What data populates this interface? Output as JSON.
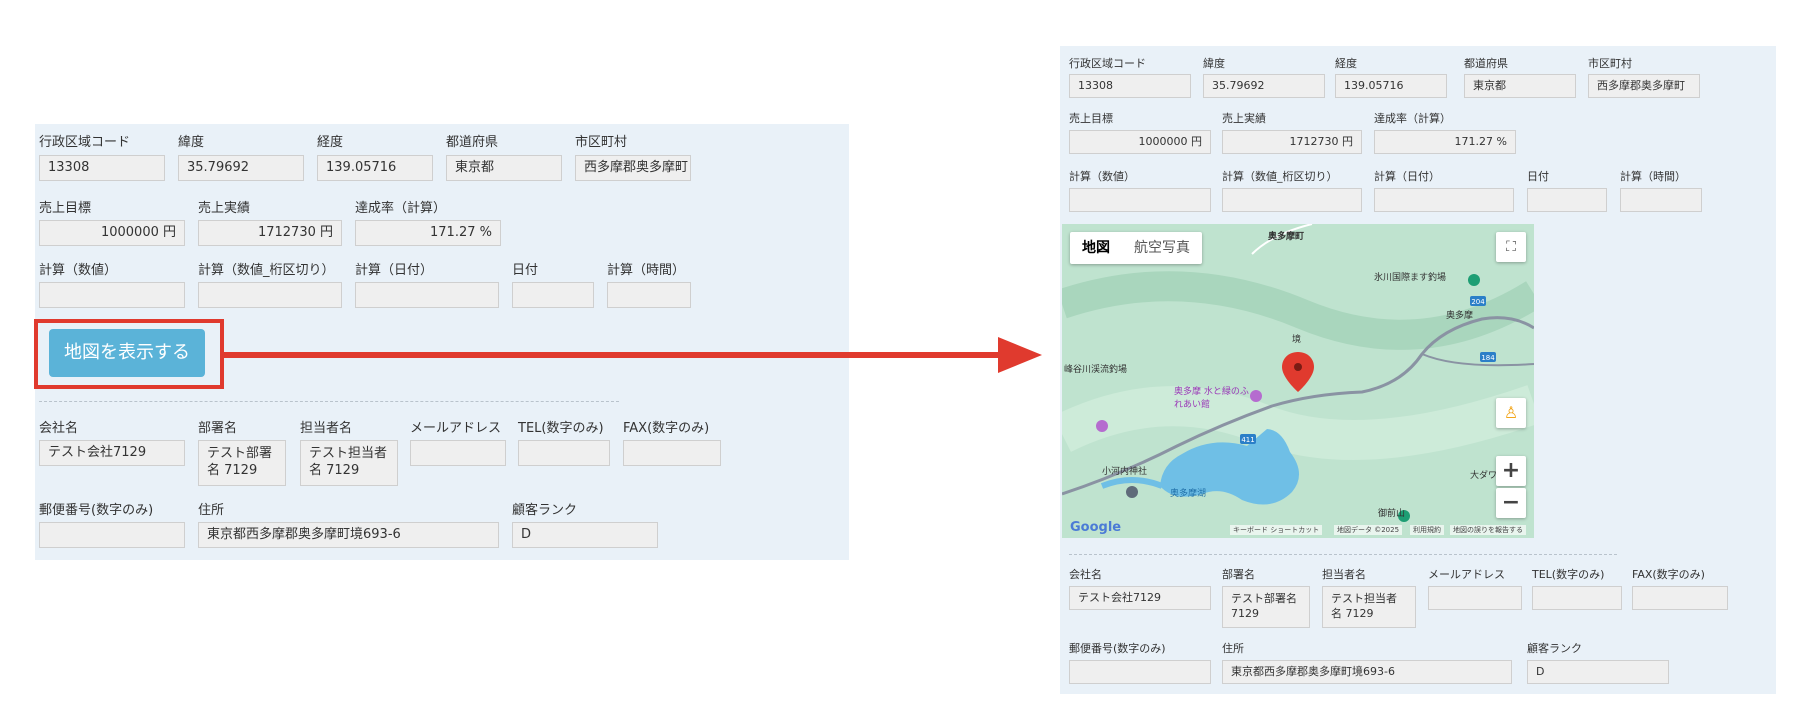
{
  "labels": {
    "admin_code": "行政区域コード",
    "latitude": "緯度",
    "longitude": "経度",
    "prefecture": "都道府県",
    "city": "市区町村",
    "sales_target": "売上目標",
    "sales_actual": "売上実績",
    "achievement": "達成率（計算）",
    "calc_number": "計算（数値）",
    "calc_number_sep": "計算（数値_桁区切り）",
    "calc_date": "計算（日付）",
    "date": "日付",
    "calc_time": "計算（時間）",
    "company": "会社名",
    "department": "部署名",
    "person": "担当者名",
    "email": "メールアドレス",
    "tel": "TEL(数字のみ)",
    "fax": "FAX(数字のみ)",
    "zip": "郵便番号(数字のみ)",
    "address": "住所",
    "rank": "顧客ランク"
  },
  "values": {
    "admin_code": "13308",
    "latitude": "35.79692",
    "longitude": "139.05716",
    "prefecture": "東京都",
    "city": "西多摩郡奥多摩町",
    "sales_target": "1000000 円",
    "sales_actual": "1712730 円",
    "achievement": "171.27 %",
    "calc_number": "",
    "calc_number_sep": "",
    "calc_date": "",
    "date": "",
    "calc_time": "",
    "company": "テスト会社7129",
    "department": "テスト部署名 7129",
    "person": "テスト担当者名 7129",
    "email": "",
    "tel": "",
    "fax": "",
    "zip": "",
    "address": "東京都西多摩郡奥多摩町境693-6",
    "rank": "D"
  },
  "show_map_button": "地図を表示する",
  "map": {
    "tab_map": "地図",
    "tab_satellite": "航空写真",
    "google_logo": "Google",
    "footer": {
      "shortcuts": "キーボード ショートカット",
      "map_data": "地図データ ©2025",
      "terms": "利用規約",
      "report": "地図の誤りを報告する"
    },
    "places": {
      "town": "奥多摩町",
      "fishing": "氷川国際ます釣場",
      "okutama": "奥多摩",
      "sakai": "境",
      "valley": "峰谷川渓流釣場",
      "park": "奥多摩 水と緑のふれあい館",
      "shrine": "小河内神社",
      "lake": "奥多摩湖",
      "daiwa": "大ダワ",
      "mountain": "御前山",
      "route204": "204",
      "route184": "184",
      "route411": "411"
    },
    "colors": {
      "land": "#bfe3cf",
      "water": "#6fbfe6",
      "road": "#8a93a3",
      "pin": "#e03a2e"
    }
  },
  "accent_color": "#e03a2e",
  "button_color": "#5bb3d8"
}
